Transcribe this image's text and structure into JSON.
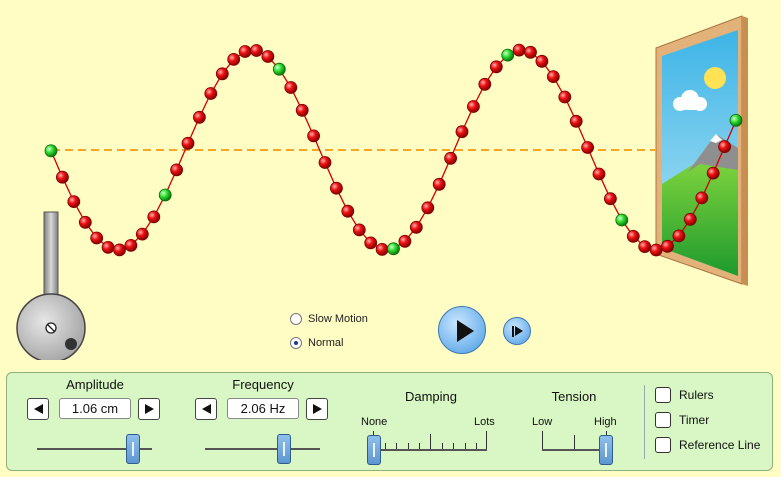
{
  "motion": {
    "options": [
      {
        "label": "Slow Motion",
        "selected": false
      },
      {
        "label": "Normal",
        "selected": true
      }
    ]
  },
  "controls": {
    "amplitude": {
      "title": "Amplitude",
      "value": "1.06 cm",
      "slider_fraction": 0.83
    },
    "frequency": {
      "title": "Frequency",
      "value": "2.06 Hz",
      "slider_fraction": 0.69
    },
    "damping": {
      "title": "Damping",
      "low_label": "None",
      "high_label": "Lots",
      "slider_fraction": 0.0
    },
    "tension": {
      "title": "Tension",
      "low_label": "Low",
      "high_label": "High",
      "slider_fraction": 1.0
    }
  },
  "checkboxes": [
    {
      "label": "Rulers",
      "checked": false
    },
    {
      "label": "Timer",
      "checked": false
    },
    {
      "label": "Reference Line",
      "checked": false
    }
  ],
  "colors": {
    "background": "#fffdc3",
    "bead_red": "#e00000",
    "bead_green": "#22dd22",
    "reference_line": "#f5a623",
    "panel": "#d8f7c4"
  },
  "icons": {
    "play": "play-icon",
    "step": "step-forward-icon"
  }
}
